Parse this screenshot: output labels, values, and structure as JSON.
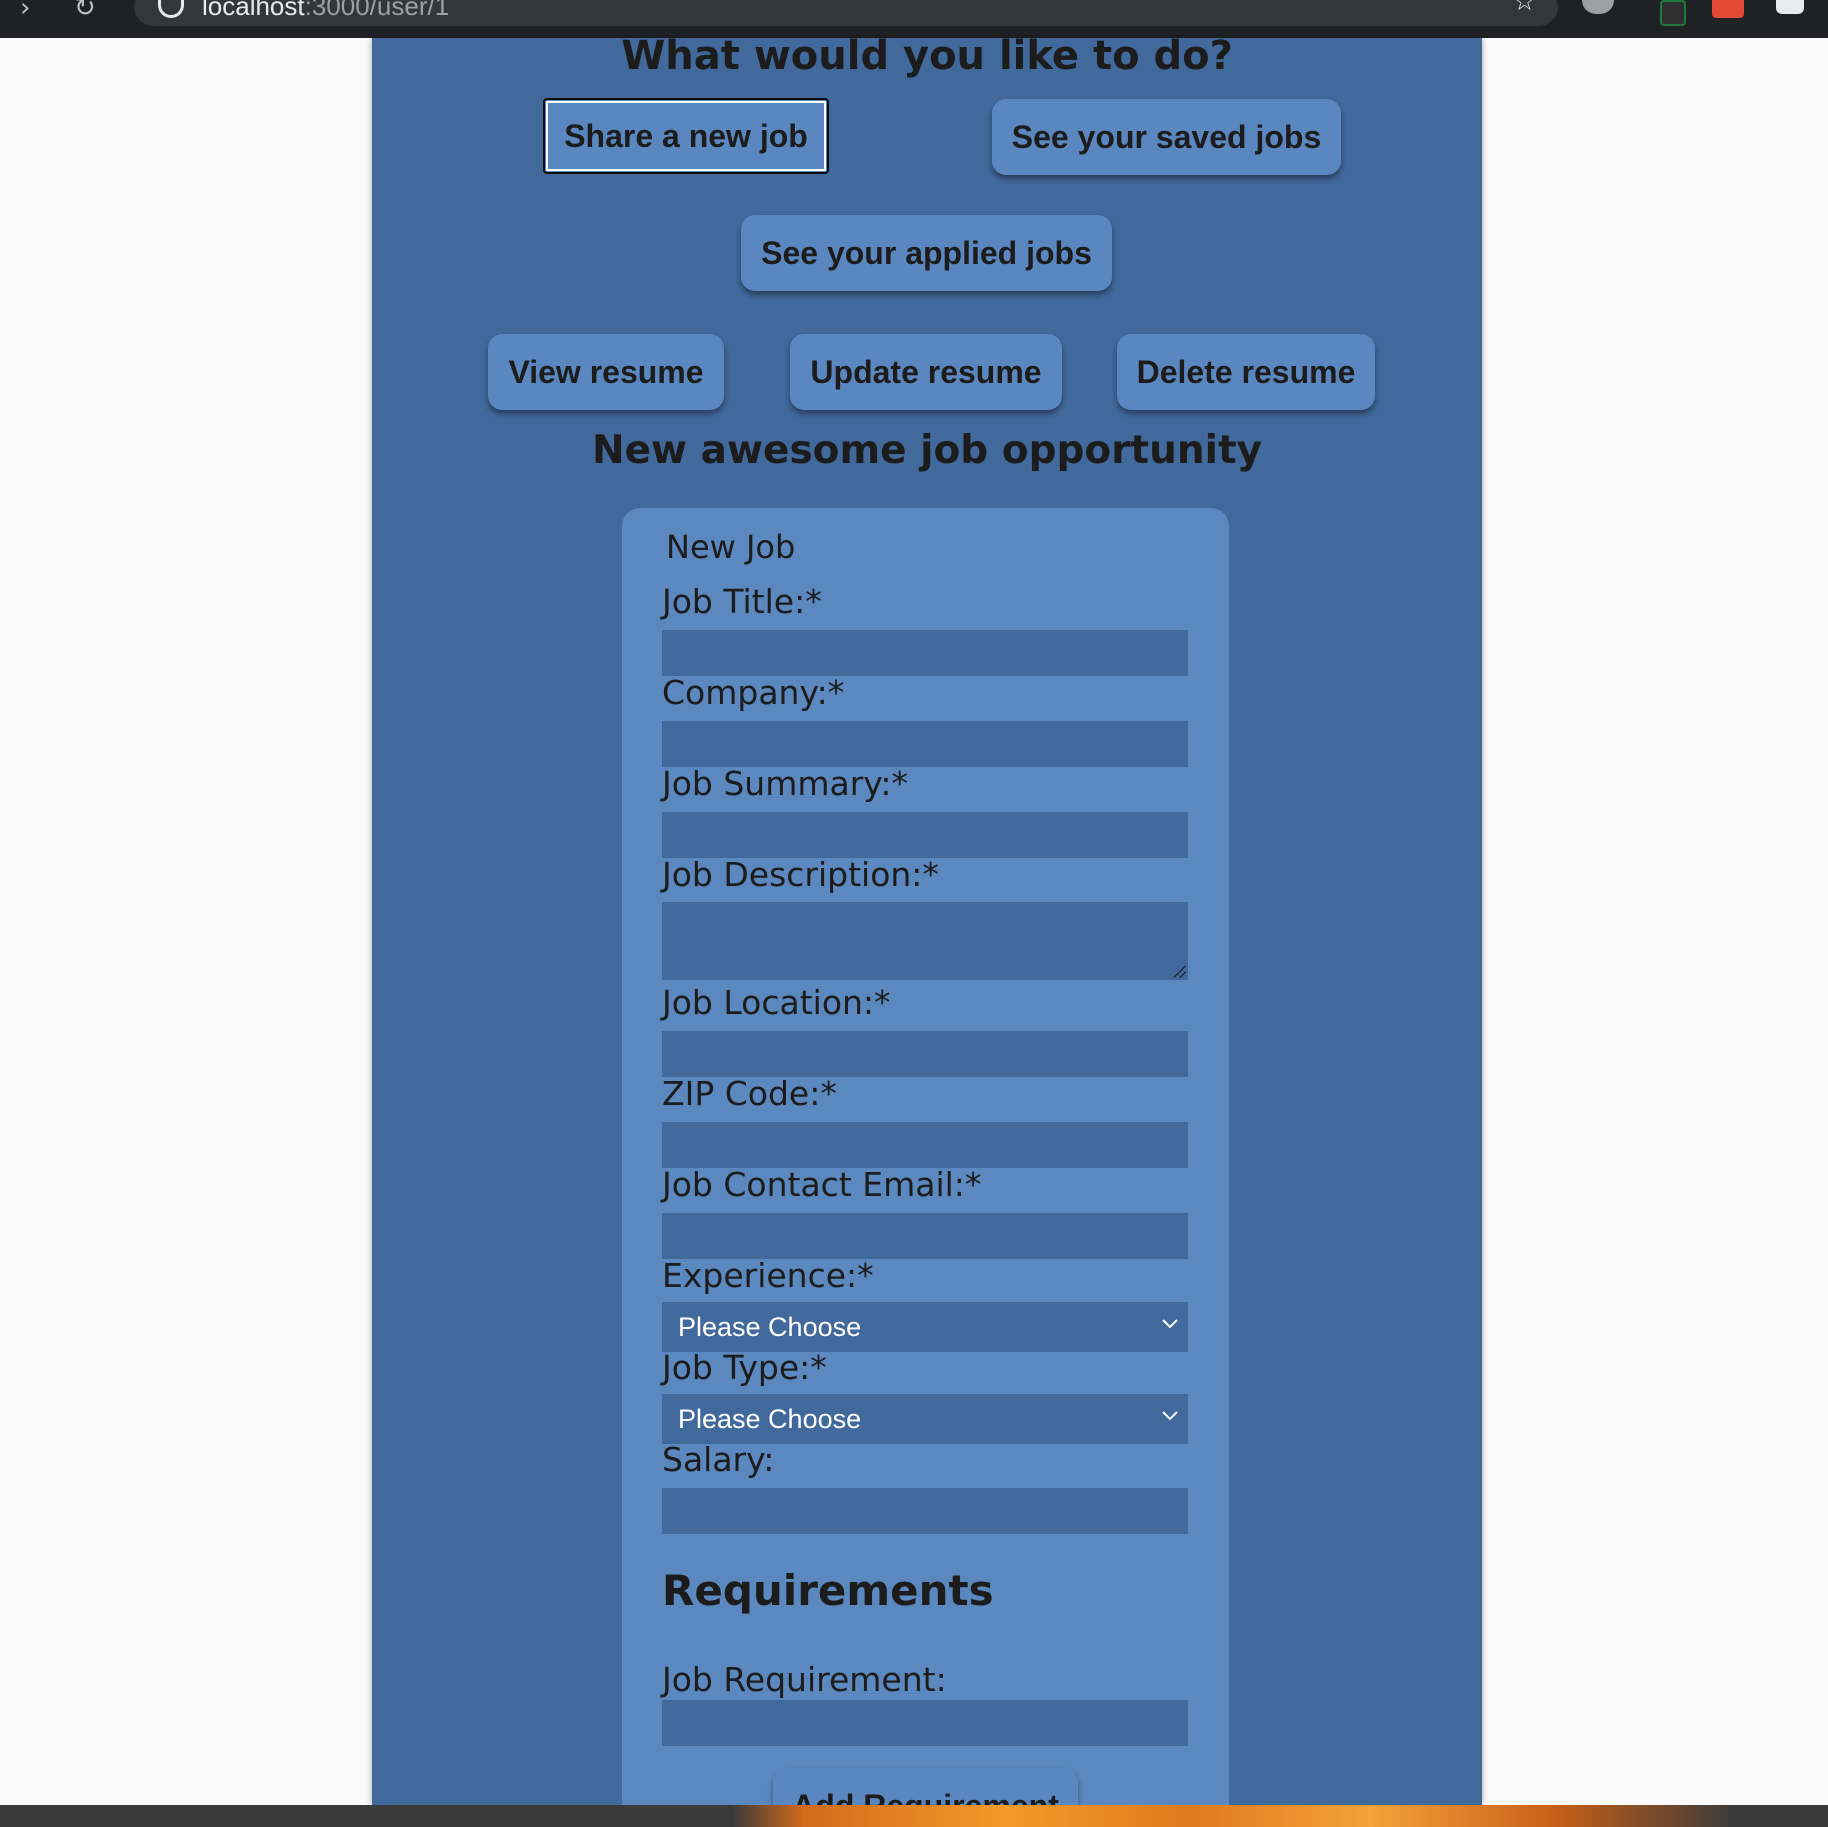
{
  "browser": {
    "url_host": "localhost",
    "url_path": ":3000/user/1"
  },
  "page": {
    "heading": "What would you like to do?",
    "actions": {
      "share_new_job": "Share a new job",
      "see_saved_jobs": "See your saved jobs",
      "see_applied_jobs": "See your applied jobs",
      "view_resume": "View resume",
      "update_resume": "Update resume",
      "delete_resume": "Delete resume"
    },
    "section_title": "New awesome job opportunity"
  },
  "form": {
    "legend": "New Job",
    "job_title": {
      "label": "Job Title:*",
      "value": ""
    },
    "company": {
      "label": "Company:*",
      "value": ""
    },
    "job_summary": {
      "label": "Job Summary:*",
      "value": ""
    },
    "job_description": {
      "label": "Job Description:*",
      "value": ""
    },
    "job_location": {
      "label": "Job Location:*",
      "value": ""
    },
    "zip_code": {
      "label": "ZIP Code:*",
      "value": ""
    },
    "contact_email": {
      "label": "Job Contact Email:*",
      "value": ""
    },
    "experience": {
      "label": "Experience:*",
      "selected": "Please Choose"
    },
    "job_type": {
      "label": "Job Type:*",
      "selected": "Please Choose"
    },
    "salary": {
      "label": "Salary:",
      "value": ""
    },
    "requirements_heading": "Requirements",
    "job_requirement": {
      "label": "Job Requirement:",
      "value": ""
    },
    "add_requirement": "Add Requirement"
  },
  "colors": {
    "page_bg": "#41699b",
    "card_bg": "#5b88be",
    "button_bg": "#5a87bf",
    "input_bg": "#41699b"
  }
}
